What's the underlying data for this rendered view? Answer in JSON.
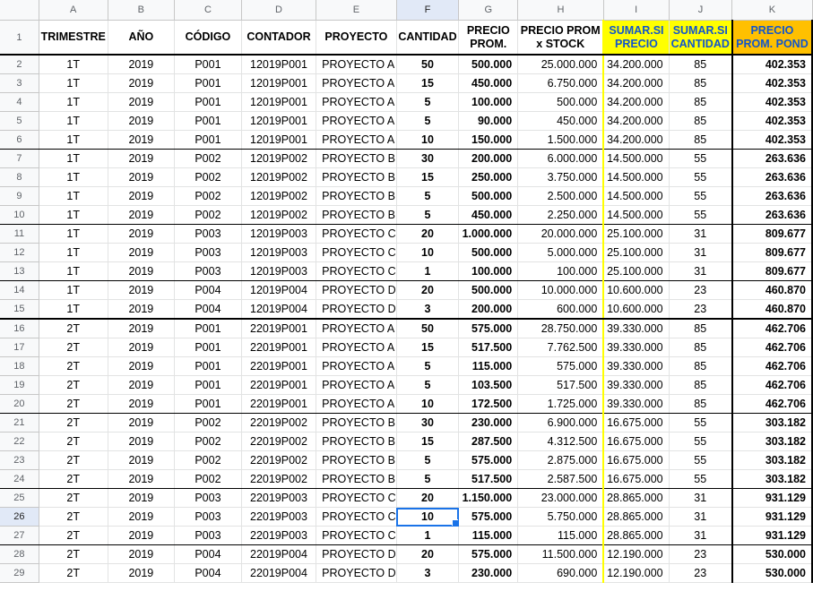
{
  "columns": [
    "A",
    "B",
    "C",
    "D",
    "E",
    "F",
    "G",
    "H",
    "I",
    "J",
    "K"
  ],
  "headers": [
    "TRIMESTRE",
    "AÑO",
    "CÓDIGO",
    "CONTADOR",
    "PROYECTO",
    "CANTIDAD",
    "PRECIO PROM.",
    "PRECIO PROM x STOCK",
    "SUMAR.SI PRECIO",
    "SUMAR.SI CANTIDAD",
    "PRECIO PROM. POND"
  ],
  "header_row_number": "1",
  "active_cell": "F26",
  "colors": {
    "sumarsi_header": "#ffff00",
    "pond_header": "#ffc000",
    "header_text": "#1155cc",
    "selection": "#1a73e8"
  },
  "rows": [
    {
      "n": "2",
      "cells": [
        "1T",
        "2019",
        "P001",
        "12019P001",
        "PROYECTO A",
        "50",
        "500.000",
        "25.000.000",
        "34.200.000",
        "85",
        "402.353"
      ]
    },
    {
      "n": "3",
      "cells": [
        "1T",
        "2019",
        "P001",
        "12019P001",
        "PROYECTO A",
        "15",
        "450.000",
        "6.750.000",
        "34.200.000",
        "85",
        "402.353"
      ]
    },
    {
      "n": "4",
      "cells": [
        "1T",
        "2019",
        "P001",
        "12019P001",
        "PROYECTO A",
        "5",
        "100.000",
        "500.000",
        "34.200.000",
        "85",
        "402.353"
      ]
    },
    {
      "n": "5",
      "cells": [
        "1T",
        "2019",
        "P001",
        "12019P001",
        "PROYECTO A",
        "5",
        "90.000",
        "450.000",
        "34.200.000",
        "85",
        "402.353"
      ]
    },
    {
      "n": "6",
      "cells": [
        "1T",
        "2019",
        "P001",
        "12019P001",
        "PROYECTO A",
        "10",
        "150.000",
        "1.500.000",
        "34.200.000",
        "85",
        "402.353"
      ]
    },
    {
      "n": "7",
      "cells": [
        "1T",
        "2019",
        "P002",
        "12019P002",
        "PROYECTO B",
        "30",
        "200.000",
        "6.000.000",
        "14.500.000",
        "55",
        "263.636"
      ]
    },
    {
      "n": "8",
      "cells": [
        "1T",
        "2019",
        "P002",
        "12019P002",
        "PROYECTO B",
        "15",
        "250.000",
        "3.750.000",
        "14.500.000",
        "55",
        "263.636"
      ]
    },
    {
      "n": "9",
      "cells": [
        "1T",
        "2019",
        "P002",
        "12019P002",
        "PROYECTO B",
        "5",
        "500.000",
        "2.500.000",
        "14.500.000",
        "55",
        "263.636"
      ]
    },
    {
      "n": "10",
      "cells": [
        "1T",
        "2019",
        "P002",
        "12019P002",
        "PROYECTO B",
        "5",
        "450.000",
        "2.250.000",
        "14.500.000",
        "55",
        "263.636"
      ]
    },
    {
      "n": "11",
      "cells": [
        "1T",
        "2019",
        "P003",
        "12019P003",
        "PROYECTO C",
        "20",
        "1.000.000",
        "20.000.000",
        "25.100.000",
        "31",
        "809.677"
      ]
    },
    {
      "n": "12",
      "cells": [
        "1T",
        "2019",
        "P003",
        "12019P003",
        "PROYECTO C",
        "10",
        "500.000",
        "5.000.000",
        "25.100.000",
        "31",
        "809.677"
      ]
    },
    {
      "n": "13",
      "cells": [
        "1T",
        "2019",
        "P003",
        "12019P003",
        "PROYECTO C",
        "1",
        "100.000",
        "100.000",
        "25.100.000",
        "31",
        "809.677"
      ]
    },
    {
      "n": "14",
      "cells": [
        "1T",
        "2019",
        "P004",
        "12019P004",
        "PROYECTO D",
        "20",
        "500.000",
        "10.000.000",
        "10.600.000",
        "23",
        "460.870"
      ]
    },
    {
      "n": "15",
      "cells": [
        "1T",
        "2019",
        "P004",
        "12019P004",
        "PROYECTO D",
        "3",
        "200.000",
        "600.000",
        "10.600.000",
        "23",
        "460.870"
      ]
    },
    {
      "n": "16",
      "cells": [
        "2T",
        "2019",
        "P001",
        "22019P001",
        "PROYECTO A",
        "50",
        "575.000",
        "28.750.000",
        "39.330.000",
        "85",
        "462.706"
      ]
    },
    {
      "n": "17",
      "cells": [
        "2T",
        "2019",
        "P001",
        "22019P001",
        "PROYECTO A",
        "15",
        "517.500",
        "7.762.500",
        "39.330.000",
        "85",
        "462.706"
      ]
    },
    {
      "n": "18",
      "cells": [
        "2T",
        "2019",
        "P001",
        "22019P001",
        "PROYECTO A",
        "5",
        "115.000",
        "575.000",
        "39.330.000",
        "85",
        "462.706"
      ]
    },
    {
      "n": "19",
      "cells": [
        "2T",
        "2019",
        "P001",
        "22019P001",
        "PROYECTO A",
        "5",
        "103.500",
        "517.500",
        "39.330.000",
        "85",
        "462.706"
      ]
    },
    {
      "n": "20",
      "cells": [
        "2T",
        "2019",
        "P001",
        "22019P001",
        "PROYECTO A",
        "10",
        "172.500",
        "1.725.000",
        "39.330.000",
        "85",
        "462.706"
      ]
    },
    {
      "n": "21",
      "cells": [
        "2T",
        "2019",
        "P002",
        "22019P002",
        "PROYECTO B",
        "30",
        "230.000",
        "6.900.000",
        "16.675.000",
        "55",
        "303.182"
      ]
    },
    {
      "n": "22",
      "cells": [
        "2T",
        "2019",
        "P002",
        "22019P002",
        "PROYECTO B",
        "15",
        "287.500",
        "4.312.500",
        "16.675.000",
        "55",
        "303.182"
      ]
    },
    {
      "n": "23",
      "cells": [
        "2T",
        "2019",
        "P002",
        "22019P002",
        "PROYECTO B",
        "5",
        "575.000",
        "2.875.000",
        "16.675.000",
        "55",
        "303.182"
      ]
    },
    {
      "n": "24",
      "cells": [
        "2T",
        "2019",
        "P002",
        "22019P002",
        "PROYECTO B",
        "5",
        "517.500",
        "2.587.500",
        "16.675.000",
        "55",
        "303.182"
      ]
    },
    {
      "n": "25",
      "cells": [
        "2T",
        "2019",
        "P003",
        "22019P003",
        "PROYECTO C",
        "20",
        "1.150.000",
        "23.000.000",
        "28.865.000",
        "31",
        "931.129"
      ]
    },
    {
      "n": "26",
      "cells": [
        "2T",
        "2019",
        "P003",
        "22019P003",
        "PROYECTO C",
        "10",
        "575.000",
        "5.750.000",
        "28.865.000",
        "31",
        "931.129"
      ]
    },
    {
      "n": "27",
      "cells": [
        "2T",
        "2019",
        "P003",
        "22019P003",
        "PROYECTO C",
        "1",
        "115.000",
        "115.000",
        "28.865.000",
        "31",
        "931.129"
      ]
    },
    {
      "n": "28",
      "cells": [
        "2T",
        "2019",
        "P004",
        "22019P004",
        "PROYECTO D",
        "20",
        "575.000",
        "11.500.000",
        "12.190.000",
        "23",
        "530.000"
      ]
    },
    {
      "n": "29",
      "cells": [
        "2T",
        "2019",
        "P004",
        "22019P004",
        "PROYECTO D",
        "3",
        "230.000",
        "690.000",
        "12.190.000",
        "23",
        "530.000"
      ]
    }
  ]
}
